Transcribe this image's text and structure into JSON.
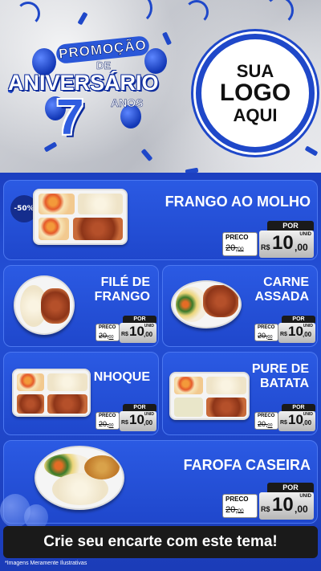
{
  "header": {
    "badge": {
      "promo": "PROMOÇÃO",
      "de": "DE",
      "aniversario": "ANIVERSÁRIO",
      "number": "7",
      "anos": "ANOS"
    },
    "logo": {
      "line1": "SUA",
      "line2": "LOGO",
      "line3": "AQUI"
    }
  },
  "colors": {
    "brand_blue": "#1f48c9",
    "panel_blue": "#2451d8",
    "dark": "#1a1a1a"
  },
  "products": [
    {
      "name": "FRANGO AO MOLHO",
      "discount": "-50%",
      "preco_label": "PRECO",
      "por_label": "POR",
      "old_price": "20,",
      "old_cents": "00",
      "currency": "R$",
      "price": "10",
      "cents": ",00",
      "unit": "UNID"
    },
    {
      "name_line1": "FILÉ DE",
      "name_line2": "FRANGO",
      "preco_label": "PRECO",
      "por_label": "POR",
      "old_price": "20,",
      "old_cents": "00",
      "currency": "R$",
      "price": "10",
      "cents": ",00",
      "unit": "UNID"
    },
    {
      "name_line1": "CARNE",
      "name_line2": "ASSADA",
      "preco_label": "PRECO",
      "por_label": "POR",
      "old_price": "20,",
      "old_cents": "00",
      "currency": "R$",
      "price": "10",
      "cents": ",00",
      "unit": "UNID"
    },
    {
      "name": "NHOQUE",
      "preco_label": "PRECO",
      "por_label": "POR",
      "old_price": "20,",
      "old_cents": "00",
      "currency": "R$",
      "price": "10",
      "cents": ",00",
      "unit": "UNID"
    },
    {
      "name_line1": "PURE DE",
      "name_line2": "BATATA",
      "preco_label": "PRECO",
      "por_label": "POR",
      "old_price": "20,",
      "old_cents": "00",
      "currency": "R$",
      "price": "10",
      "cents": ",00",
      "unit": "UNID"
    },
    {
      "name": "FAROFA CASEIRA",
      "preco_label": "PRECO",
      "por_label": "POR",
      "old_price": "20,",
      "old_cents": "00",
      "currency": "R$",
      "price": "10",
      "cents": ",00",
      "unit": "UNID"
    }
  ],
  "banner": {
    "text": "Crie seu encarte com este tema!"
  },
  "footnote": "*Imagens Meramente Ilustrativas"
}
